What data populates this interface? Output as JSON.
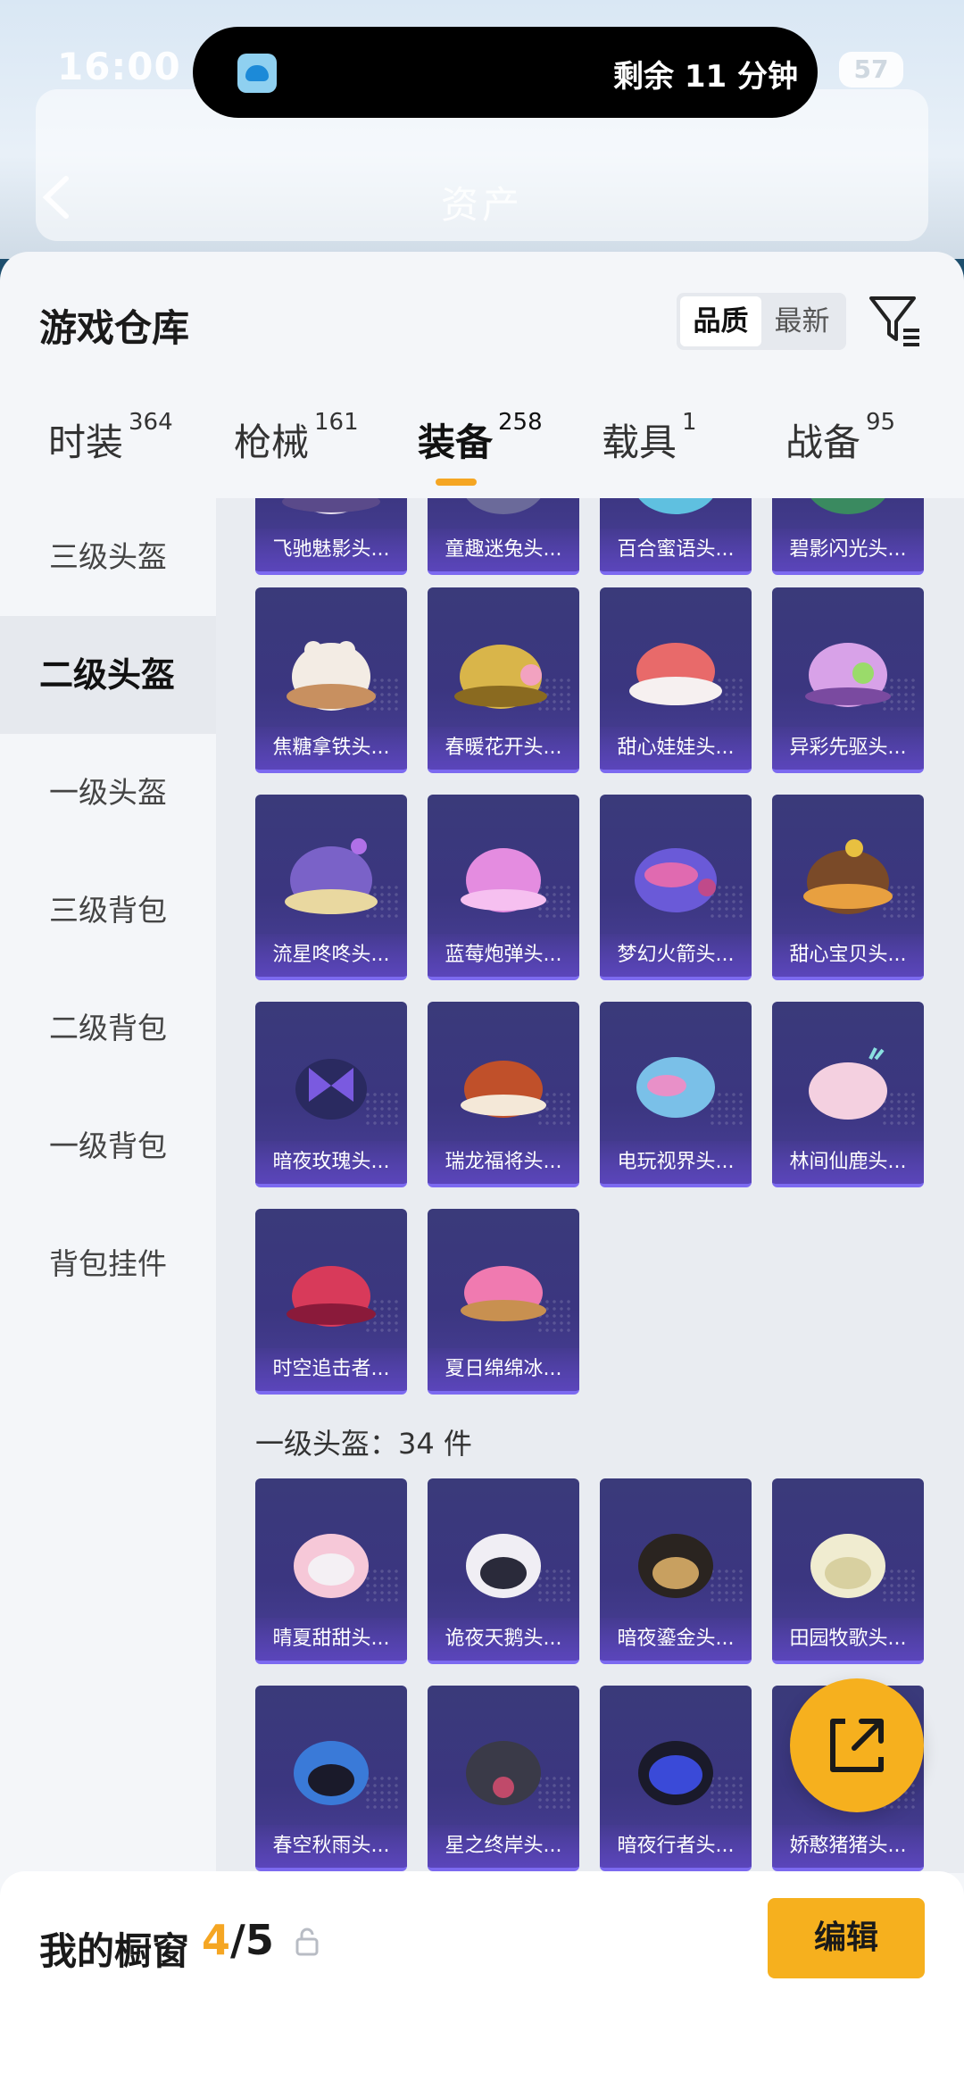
{
  "status": {
    "time": "16:00",
    "battery": "57"
  },
  "island": {
    "timer_text": "剩余 11 分钟"
  },
  "background": {
    "title": "资产"
  },
  "sheet": {
    "title": "游戏仓库",
    "sort_options": [
      "品质",
      "最新"
    ],
    "sort_selected": "品质"
  },
  "tabs": [
    {
      "label": "时装",
      "count": "364"
    },
    {
      "label": "枪械",
      "count": "161"
    },
    {
      "label": "装备",
      "count": "258"
    },
    {
      "label": "载具",
      "count": "1"
    },
    {
      "label": "战备",
      "count": "95"
    }
  ],
  "sidebar": {
    "items": [
      "三级头盔",
      "二级头盔",
      "一级头盔",
      "三级背包",
      "二级背包",
      "一级背包",
      "背包挂件"
    ],
    "active": "二级头盔"
  },
  "grid": {
    "row0": [
      "飞驰魅影头...",
      "童趣迷兔头...",
      "百合蜜语头...",
      "碧影闪光头..."
    ],
    "level2": [
      "焦糖拿铁头...",
      "春暖花开头...",
      "甜心娃娃头...",
      "异彩先驱头...",
      "流星咚咚头...",
      "蓝莓炮弹头...",
      "梦幻火箭头...",
      "甜心宝贝头...",
      "暗夜玫瑰头...",
      "瑞龙福将头...",
      "电玩视界头...",
      "林间仙鹿头...",
      "时空追击者...",
      "夏日绵绵冰..."
    ],
    "section_label": "一级头盔：34 件",
    "level1": [
      "晴夏甜甜头...",
      "诡夜天鹅头...",
      "暗夜鎏金头...",
      "田园牧歌头...",
      "春空秋雨头...",
      "星之终岸头...",
      "暗夜行者头...",
      "娇憨猪猪头..."
    ]
  },
  "bottom": {
    "label": "我的橱窗",
    "count_current": "4",
    "count_total": "/5",
    "edit_label": "编辑"
  },
  "colors": {
    "accent": "#f5a623",
    "card_bg": "#3b3680"
  }
}
